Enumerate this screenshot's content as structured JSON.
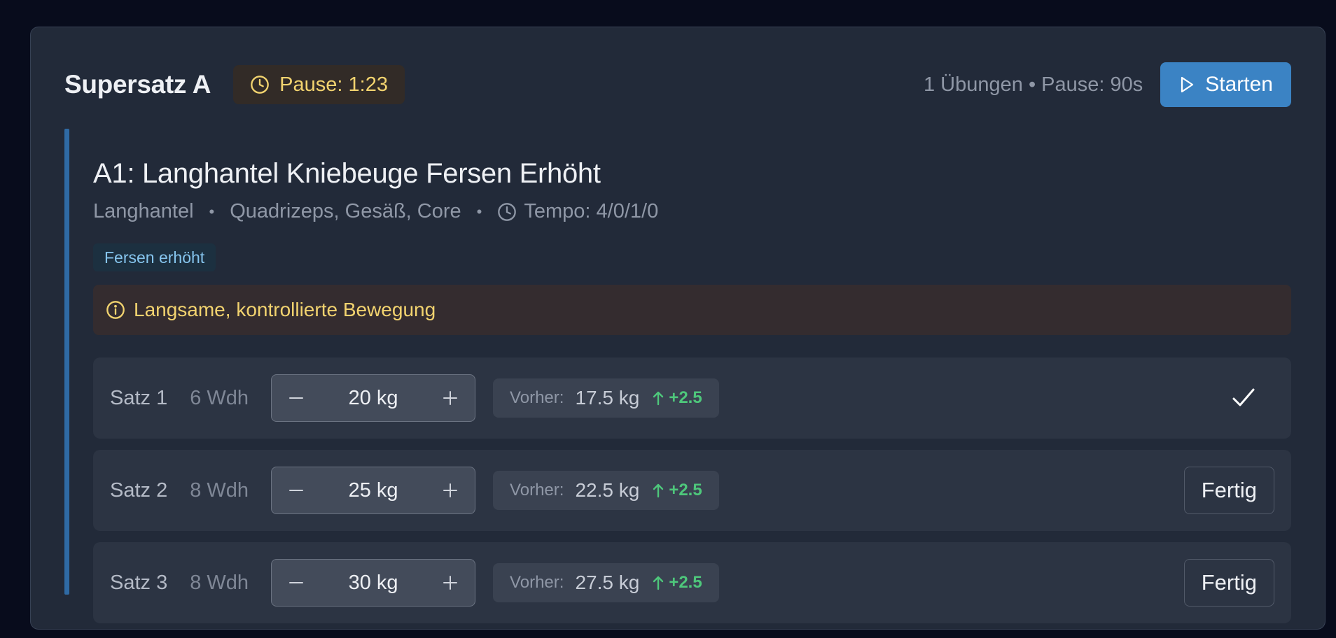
{
  "group": {
    "title": "Supersatz A",
    "pause_badge": "Pause: 1:23",
    "meta": "1 Übungen • Pause: 90s",
    "start_label": "Starten",
    "accent": "#3b83c4"
  },
  "exercise": {
    "title": "A1: Langhantel Kniebeuge Fersen Erhöht",
    "equipment": "Langhantel",
    "muscles": "Quadrizeps, Gesäß, Core",
    "tempo": "Tempo: 4/0/1/0",
    "tag": "Fersen erhöht",
    "note": "Langsame, kontrollierte Bewegung"
  },
  "sets": [
    {
      "label": "Satz 1",
      "reps": "6 Wdh",
      "weight": "20 kg",
      "prev_label": "Vorher:",
      "prev_value": "17.5 kg",
      "delta": "+2.5",
      "status": "done"
    },
    {
      "label": "Satz 2",
      "reps": "8 Wdh",
      "weight": "25 kg",
      "prev_label": "Vorher:",
      "prev_value": "22.5 kg",
      "delta": "+2.5",
      "status": "open",
      "done_label": "Fertig"
    },
    {
      "label": "Satz 3",
      "reps": "8 Wdh",
      "weight": "30 kg",
      "prev_label": "Vorher:",
      "prev_value": "27.5 kg",
      "delta": "+2.5",
      "status": "open",
      "done_label": "Fertig"
    }
  ],
  "colors": {
    "background": "#080c1c",
    "card": "#222a39",
    "pause_text": "#f2d36f",
    "delta_green": "#4ec77b",
    "tag_text": "#86c5ee"
  }
}
